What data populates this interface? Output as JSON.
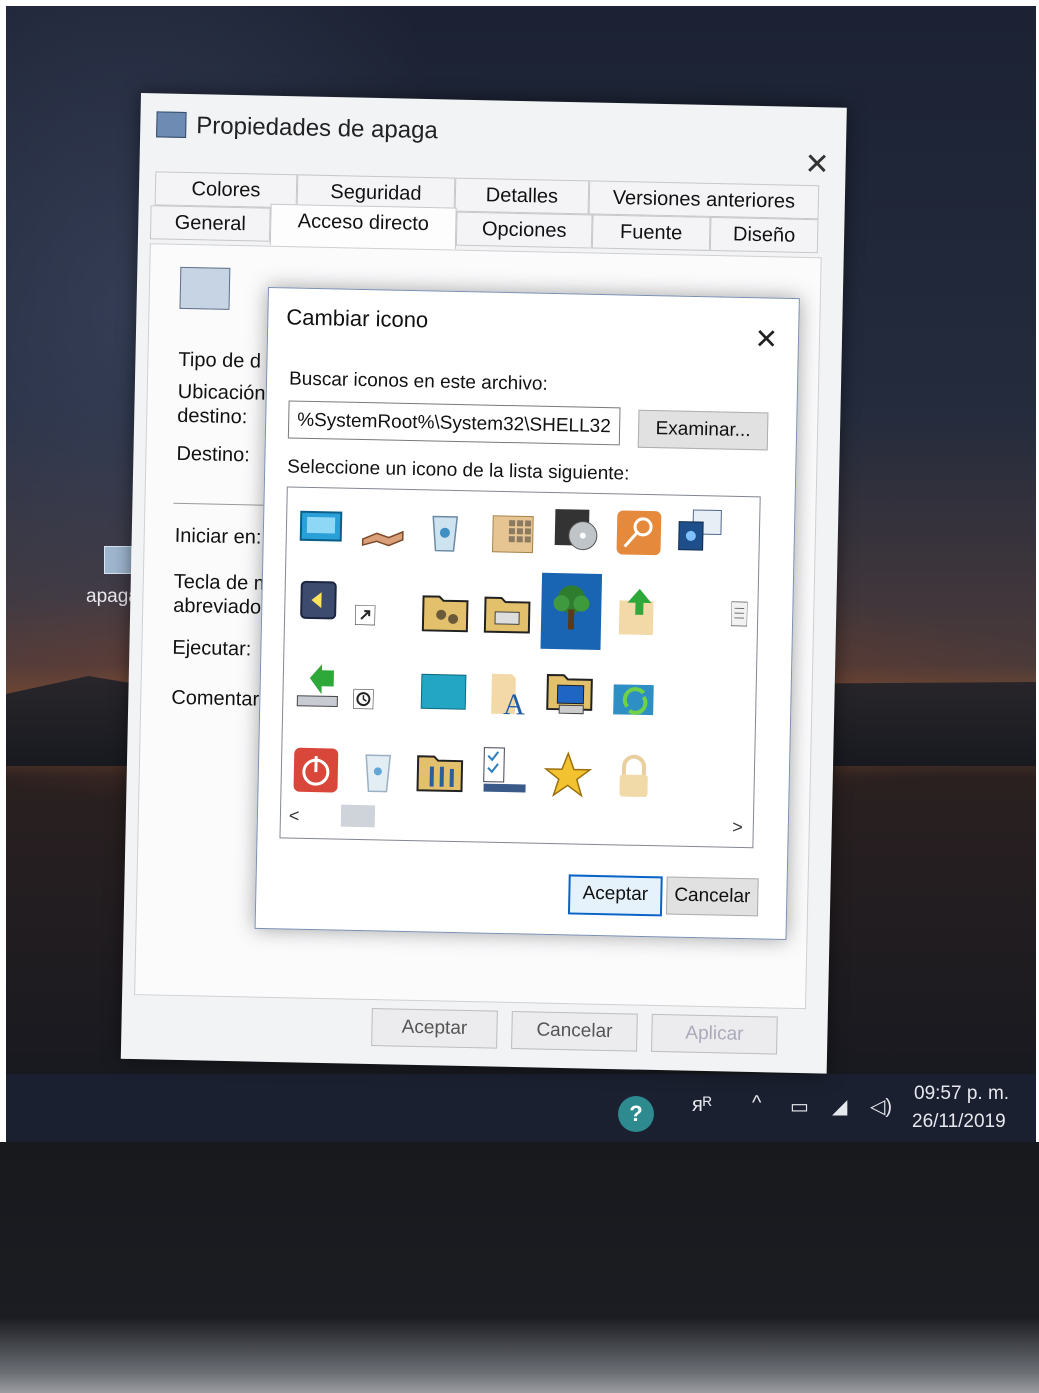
{
  "desktop": {
    "shortcut_label": "apaga",
    "clock_time": "09:57 p. m.",
    "clock_date": "26/11/2019",
    "help_glyph": "?",
    "tray_icons": [
      "people-icon",
      "chevron-up-icon",
      "battery-icon",
      "network-icon",
      "volume-icon"
    ]
  },
  "properties_window": {
    "title": "Propiedades de apaga",
    "close": "✕",
    "tabs_row1": [
      "Colores",
      "Seguridad",
      "Detalles",
      "Versiones anteriores"
    ],
    "tabs_row2": [
      "General",
      "Acceso directo",
      "Opciones",
      "Fuente",
      "Diseño"
    ],
    "active_tab": "Acceso directo",
    "fields": [
      "Tipo de d",
      "Ubicación",
      "destino:",
      "Destino:",
      "Iniciar en:",
      "Tecla de m",
      "abreviado",
      "Ejecutar:",
      "Comentari"
    ],
    "buttons": {
      "ok": "Aceptar",
      "cancel": "Cancelar",
      "apply": "Aplicar"
    }
  },
  "change_icon_dialog": {
    "title": "Cambiar icono",
    "close": "✕",
    "search_label": "Buscar iconos en este archivo:",
    "path_value": "%SystemRoot%\\System32\\SHELL32",
    "browse_button": "Examinar...",
    "select_label": "Seleccione un icono de la lista siguiente:",
    "selected_icon": "tree-icon",
    "icons": [
      [
        "monitor-icon",
        "handshake-icon",
        "recycle-bin-icon",
        "grid-folder-icon",
        "cd-drive-icon",
        "key-icon",
        "program-window-icon"
      ],
      [
        "media-player-icon",
        "shortcut-arrow-icon",
        "network-folder-icon",
        "printer-folder-icon",
        "tree-icon",
        "upload-arrow-icon",
        "document-icon"
      ],
      [
        "network-arrow-icon",
        "clock-icon",
        "blank-window-icon",
        "font-icon",
        "computer-folder-icon",
        "sync-icon",
        ""
      ],
      [
        "power-icon",
        "recycle-empty-icon",
        "tools-folder-icon",
        "task-list-icon",
        "star-icon",
        "lock-icon",
        ""
      ]
    ],
    "scroll_left": "<",
    "scroll_right": ">",
    "ok_button": "Aceptar",
    "cancel_button": "Cancelar"
  },
  "colors": {
    "selection": "#1a64b4",
    "accent_border": "#0a64c8",
    "power_red": "#d9473a",
    "folder_tan": "#d8b46a",
    "star_gold": "#f2c230",
    "tree_green": "#2e7d2e"
  }
}
